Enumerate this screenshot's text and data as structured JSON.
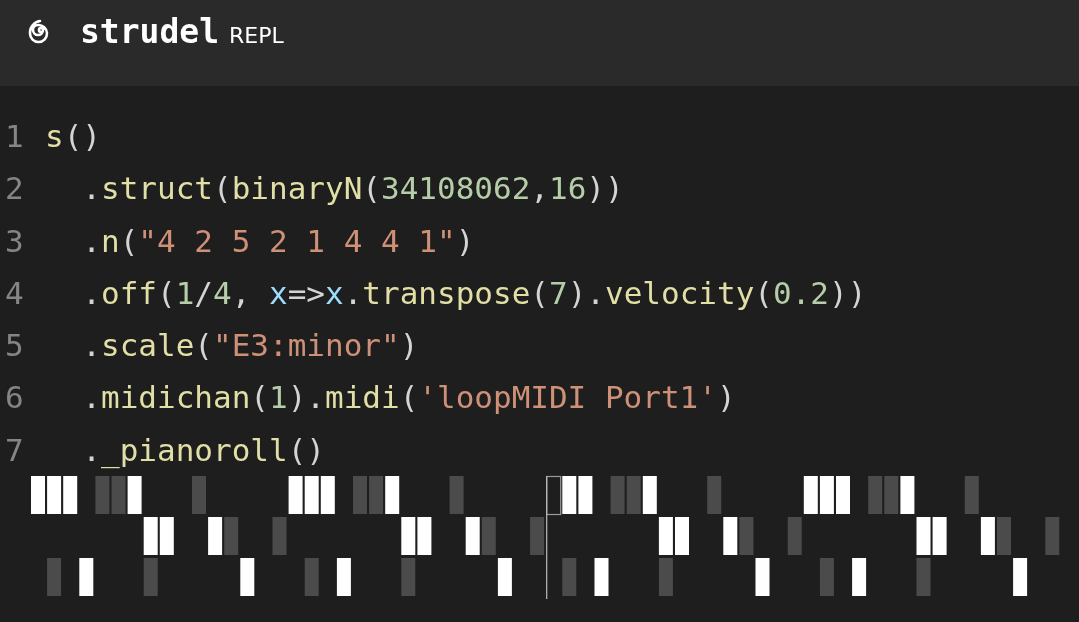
{
  "header": {
    "title": "strudel",
    "subtitle": "REPL"
  },
  "editor": {
    "lines": [
      {
        "number": "1",
        "tokens": [
          {
            "kind": "fn",
            "text": "s"
          },
          {
            "kind": "punct",
            "text": "()"
          }
        ]
      },
      {
        "number": "2",
        "tokens": [
          {
            "kind": "punct",
            "text": "  ."
          },
          {
            "kind": "fn",
            "text": "struct"
          },
          {
            "kind": "punct",
            "text": "("
          },
          {
            "kind": "fn",
            "text": "binaryN"
          },
          {
            "kind": "punct",
            "text": "("
          },
          {
            "kind": "num",
            "text": "34108062"
          },
          {
            "kind": "punct",
            "text": ","
          },
          {
            "kind": "num",
            "text": "16"
          },
          {
            "kind": "punct",
            "text": "))"
          }
        ]
      },
      {
        "number": "3",
        "tokens": [
          {
            "kind": "punct",
            "text": "  ."
          },
          {
            "kind": "fn",
            "text": "n"
          },
          {
            "kind": "punct",
            "text": "("
          },
          {
            "kind": "str",
            "text": "\"4 2 5 2 1 4 4 1\""
          },
          {
            "kind": "punct",
            "text": ")"
          }
        ]
      },
      {
        "number": "4",
        "tokens": [
          {
            "kind": "punct",
            "text": "  ."
          },
          {
            "kind": "fn",
            "text": "off"
          },
          {
            "kind": "punct",
            "text": "("
          },
          {
            "kind": "num",
            "text": "1"
          },
          {
            "kind": "punct",
            "text": "/"
          },
          {
            "kind": "num",
            "text": "4"
          },
          {
            "kind": "punct",
            "text": ", "
          },
          {
            "kind": "var",
            "text": "x"
          },
          {
            "kind": "punct",
            "text": "=>"
          },
          {
            "kind": "var",
            "text": "x"
          },
          {
            "kind": "punct",
            "text": "."
          },
          {
            "kind": "fn",
            "text": "transpose"
          },
          {
            "kind": "punct",
            "text": "("
          },
          {
            "kind": "num",
            "text": "7"
          },
          {
            "kind": "punct",
            "text": ")."
          },
          {
            "kind": "fn",
            "text": "velocity"
          },
          {
            "kind": "punct",
            "text": "("
          },
          {
            "kind": "num",
            "text": "0.2"
          },
          {
            "kind": "punct",
            "text": "))"
          }
        ]
      },
      {
        "number": "5",
        "tokens": [
          {
            "kind": "punct",
            "text": "  ."
          },
          {
            "kind": "fn",
            "text": "scale"
          },
          {
            "kind": "punct",
            "text": "("
          },
          {
            "kind": "str",
            "text": "\"E3:minor\""
          },
          {
            "kind": "punct",
            "text": ")"
          }
        ]
      },
      {
        "number": "6",
        "tokens": [
          {
            "kind": "punct",
            "text": "  ."
          },
          {
            "kind": "fn",
            "text": "midichan"
          },
          {
            "kind": "punct",
            "text": "("
          },
          {
            "kind": "num",
            "text": "1"
          },
          {
            "kind": "punct",
            "text": ")."
          },
          {
            "kind": "fn",
            "text": "midi"
          },
          {
            "kind": "punct",
            "text": "("
          },
          {
            "kind": "str",
            "text": "'loopMIDI Port1'"
          },
          {
            "kind": "punct",
            "text": ")"
          }
        ]
      },
      {
        "number": "7",
        "tokens": [
          {
            "kind": "punct",
            "text": "  ."
          },
          {
            "kind": "fn",
            "text": "_pianoroll"
          },
          {
            "kind": "punct",
            "text": "()"
          }
        ]
      }
    ]
  }
}
